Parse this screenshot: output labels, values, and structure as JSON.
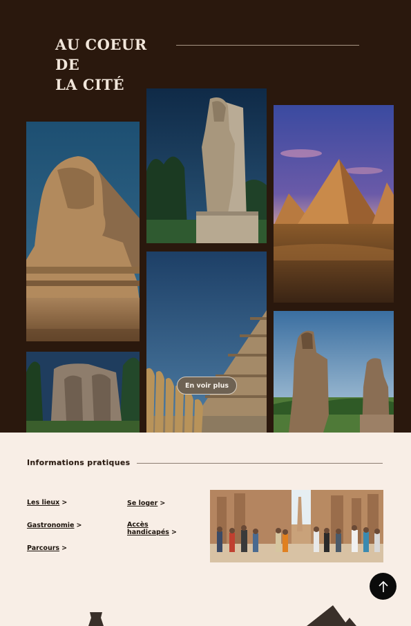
{
  "hero": {
    "heading_line1": "AU COEUR DE",
    "heading_line2": "LA CITÉ",
    "more_button": "En voir plus"
  },
  "gallery": {
    "images": [
      {
        "name": "sphinx",
        "icon": "sphinx-photo"
      },
      {
        "name": "ramesses-statue",
        "icon": "statue-photo"
      },
      {
        "name": "giza-pyramids",
        "icon": "pyramids-photo"
      },
      {
        "name": "stone-relief",
        "icon": "relief-photo"
      },
      {
        "name": "step-pyramid",
        "icon": "step-pyramid-photo"
      },
      {
        "name": "colossi-of-memnon",
        "icon": "colossi-photo"
      }
    ]
  },
  "info": {
    "title": "Informations pratiques",
    "links": {
      "lieux": "Les lieux",
      "loger": "Se loger",
      "gastronomie": "Gastronomie",
      "acces_line1": "Accès",
      "acces_line2": "handicapés",
      "parcours": "Parcours"
    },
    "chevron": ">"
  },
  "scroll_top": {
    "icon": "arrow-up-icon"
  },
  "colors": {
    "dark_bg": "#2a180d",
    "light_bg": "#f8eee6",
    "text_light": "#f1e6da",
    "text_dark": "#1d140d"
  }
}
